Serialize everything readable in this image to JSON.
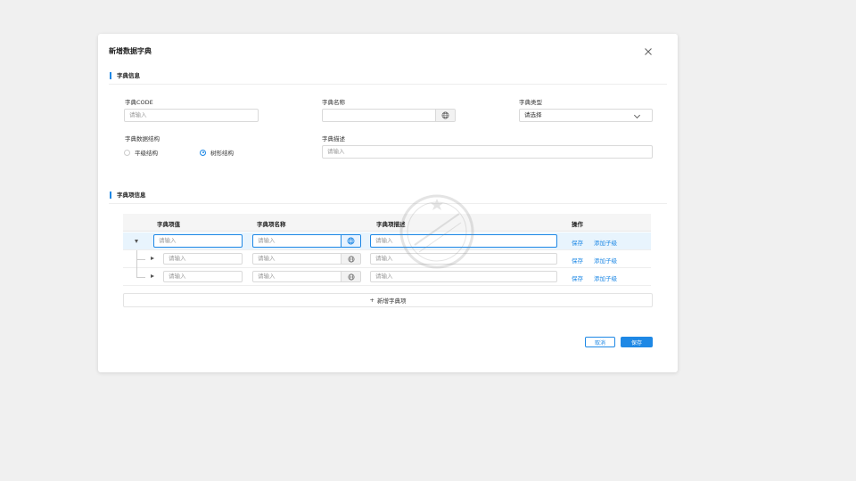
{
  "dialog": {
    "title": "新增数据字典",
    "section1_title": "字典信息",
    "section2_title": "字典项信息",
    "fields": {
      "code_label": "字典CODE",
      "code_placeholder": "请输入",
      "name_label": "字典名称",
      "type_label": "字典类型",
      "type_placeholder": "请选择",
      "structure_label": "字典数据结构",
      "structure_options": [
        "平级结构",
        "树形结构"
      ],
      "structure_selected": "树形结构",
      "desc_label": "字典描述",
      "desc_placeholder": "请输入"
    },
    "table": {
      "headers": [
        "字典项值",
        "字典项名称",
        "字典项描述",
        "操作"
      ],
      "placeholder": "请输入",
      "rows": [
        {
          "save": "保存",
          "add_child": "添加子级"
        },
        {
          "save": "保存",
          "add_child": "添加子级"
        },
        {
          "save": "保存",
          "add_child": "添加子级"
        }
      ]
    },
    "add_item_label": "新增字典项",
    "add_item_icon": "+",
    "cancel_label": "取消",
    "save_label": "保存"
  },
  "colors": {
    "accent": "#1e88e5",
    "selected_row": "#e8f4fd",
    "background": "#f0f0f0"
  },
  "icons": [
    "close-icon",
    "globe-icon",
    "chevron-down-icon",
    "caret-down-icon",
    "caret-right-icon",
    "plus-icon",
    "watermark-seal"
  ]
}
